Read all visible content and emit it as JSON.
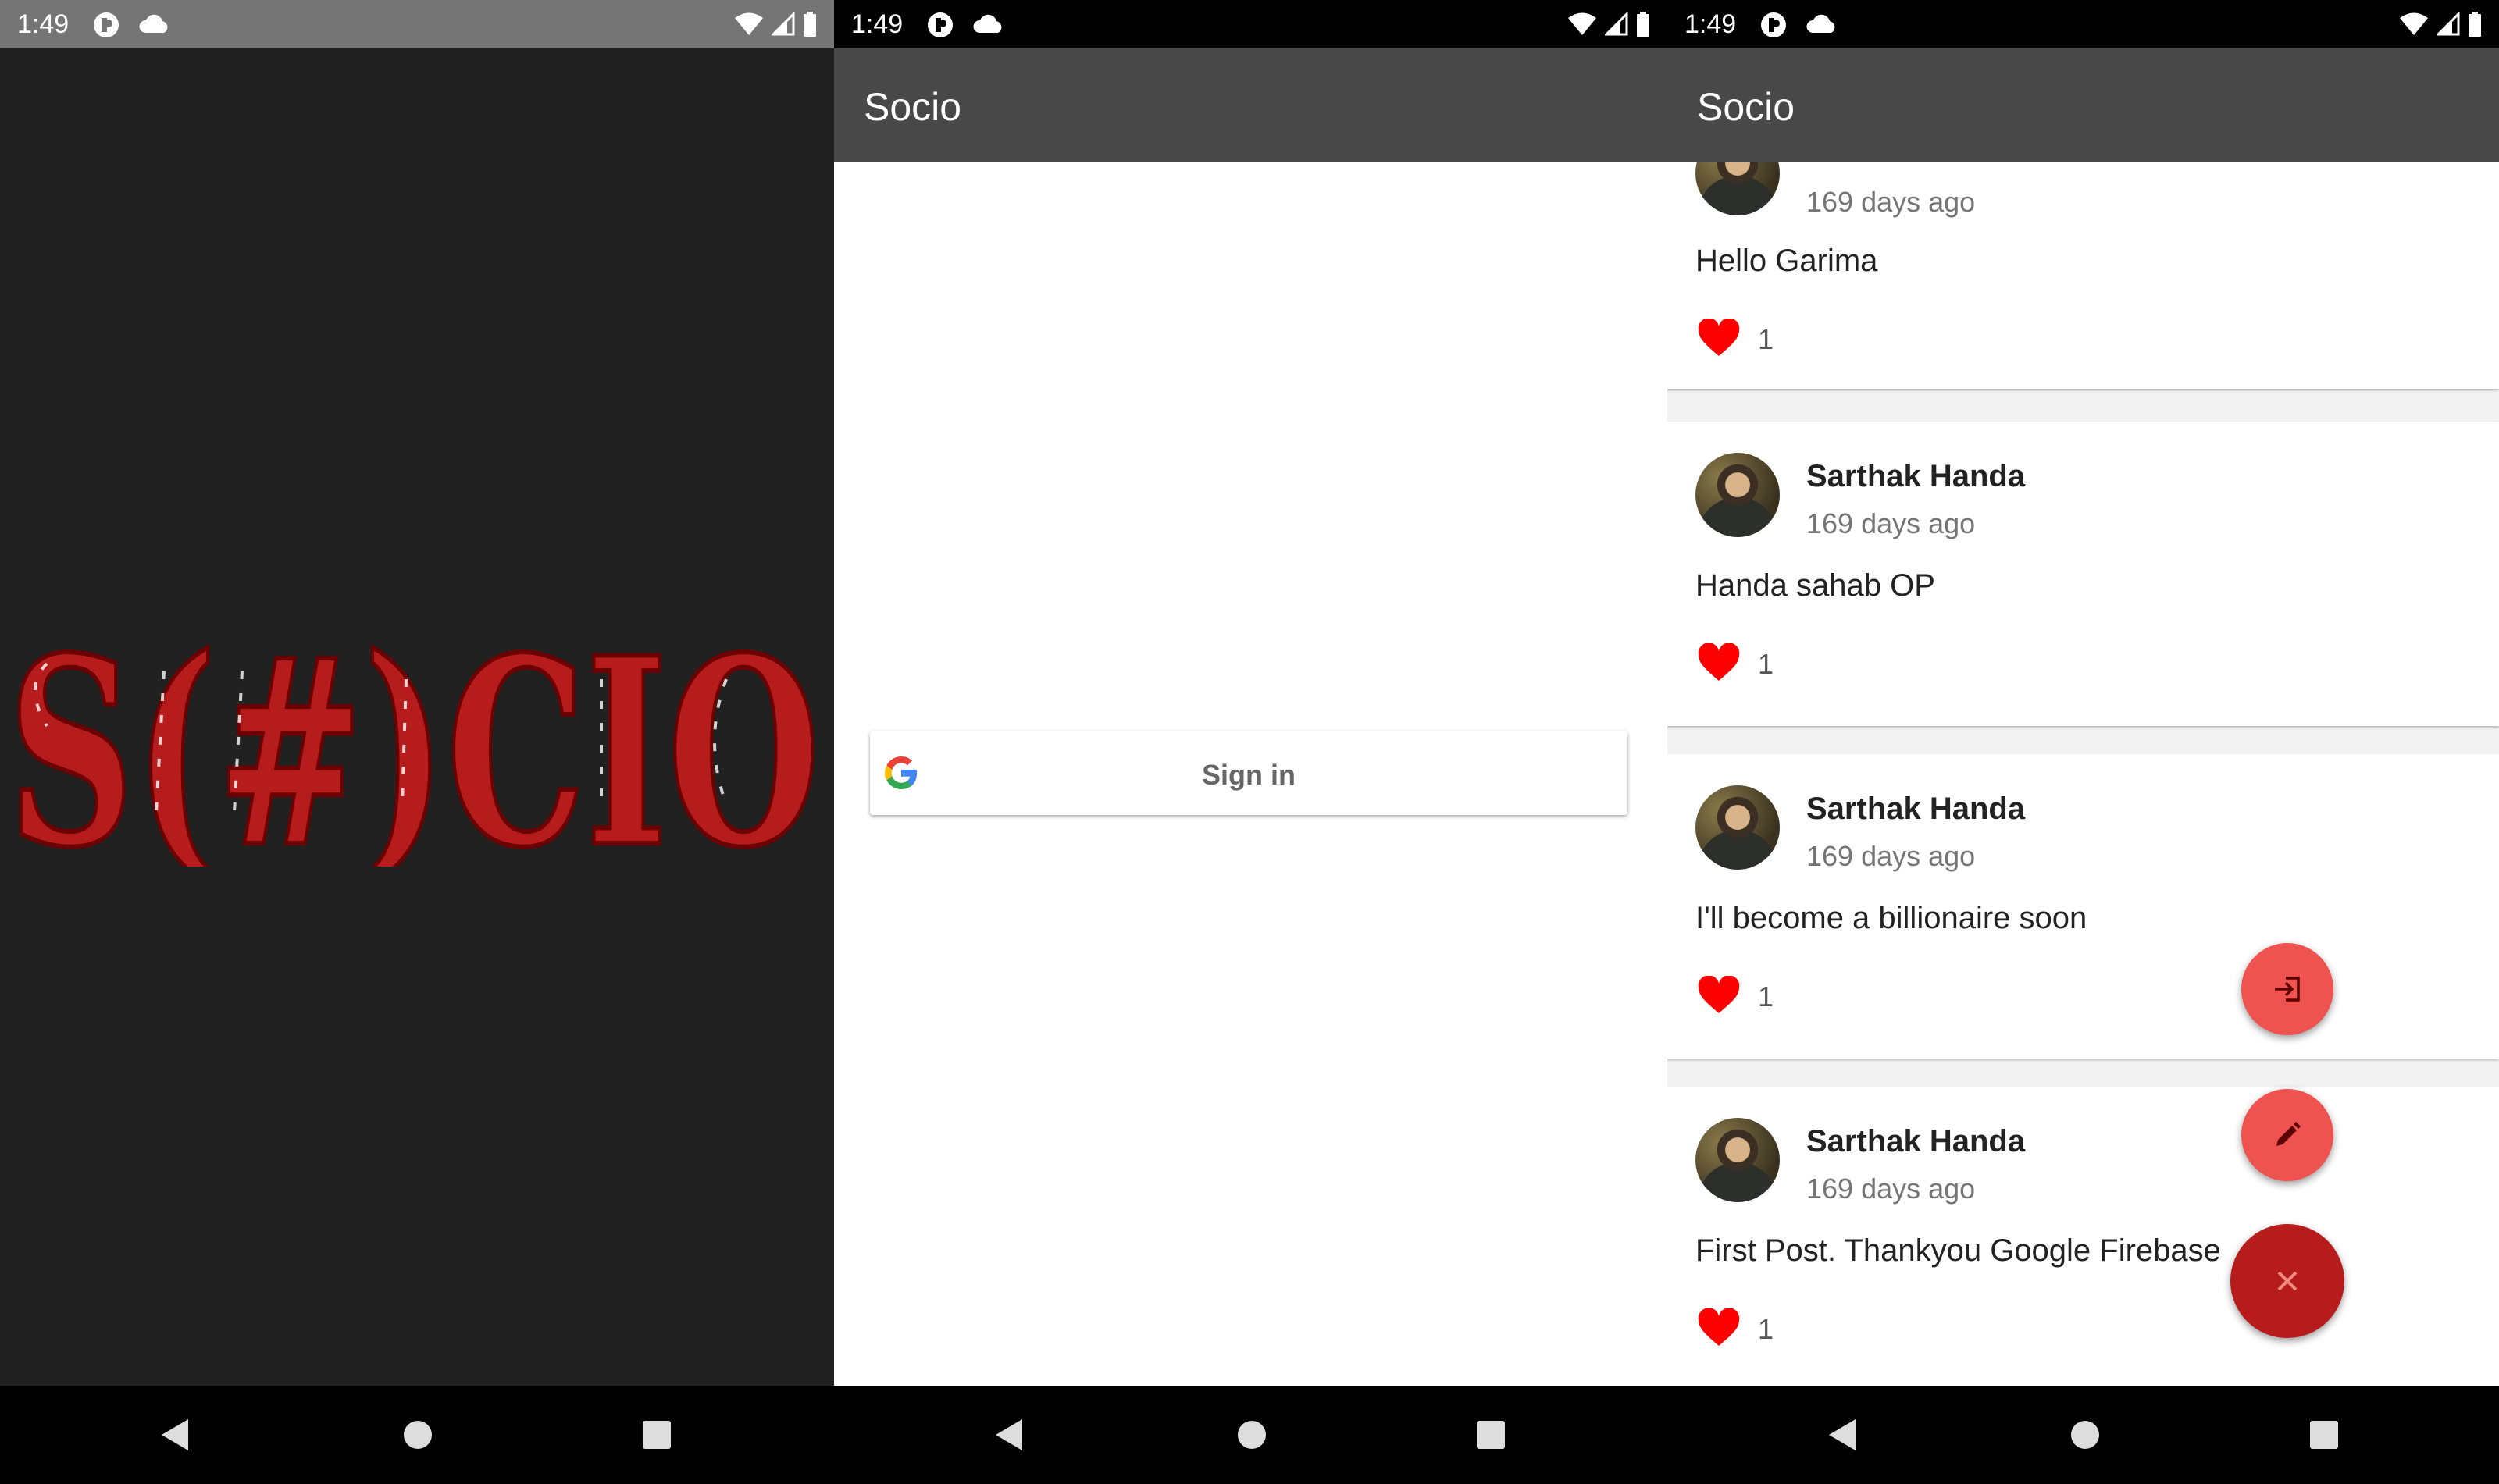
{
  "screens": [
    {
      "status": {
        "time": "1:49"
      },
      "splash": {
        "logo_text": "S(#)CIO"
      }
    },
    {
      "status": {
        "time": "1:49"
      },
      "appbar": {
        "title": "Socio"
      },
      "signin": {
        "label": "Sign in"
      }
    },
    {
      "status": {
        "time": "1:49"
      },
      "appbar": {
        "title": "Socio"
      },
      "posts": [
        {
          "author": "",
          "time": "169 days ago",
          "text": "Hello Garima",
          "likes": "1"
        },
        {
          "author": "Sarthak Handa",
          "time": "169 days ago",
          "text": "Handa sahab OP",
          "likes": "1"
        },
        {
          "author": "Sarthak Handa",
          "time": "169 days ago",
          "text": "I'll become a billionaire soon",
          "likes": "1"
        },
        {
          "author": "Sarthak Handa",
          "time": "169 days ago",
          "text": "First Post. Thankyou Google Firebase",
          "likes": "1"
        }
      ],
      "fabs": {
        "login": "login-icon",
        "edit": "pencil-icon",
        "close": "close-icon"
      }
    }
  ],
  "colors": {
    "appbar": "#484848",
    "accent": "#ef5350",
    "accent_dark": "#b71c1c",
    "logo_red": "#b71c1c",
    "like_red": "#ff0000"
  }
}
